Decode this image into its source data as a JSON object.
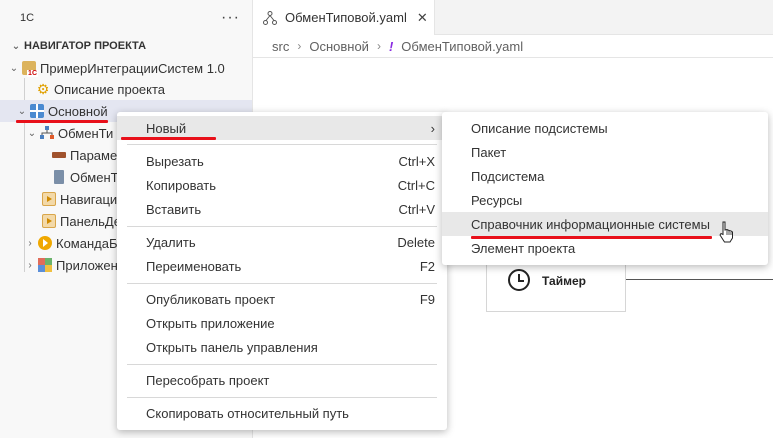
{
  "sidebar": {
    "title": "1С",
    "more": "···",
    "section": "НАВИГАТОР ПРОЕКТА",
    "items": [
      {
        "label": "ПримерИнтеграцииСистем 1.0"
      },
      {
        "label": "Описание проекта"
      },
      {
        "label": "Основной"
      },
      {
        "label": "ОбменТи"
      },
      {
        "label": "Парамет"
      },
      {
        "label": "ОбменТ"
      },
      {
        "label": "Навигаци"
      },
      {
        "label": "ПанельДе"
      },
      {
        "label": "КомандаБ"
      },
      {
        "label": "Приложен"
      }
    ]
  },
  "editor": {
    "tab": {
      "label": "ОбменТиповой.yaml",
      "close": "✕"
    },
    "breadcrumb": [
      "src",
      "Основной",
      "ОбменТиповой.yaml"
    ],
    "breadcrumb_mark": "!",
    "timer_label": "Таймер"
  },
  "context_menu": {
    "items": [
      {
        "label": "Новый",
        "shortcut": "›"
      },
      {
        "label": "Вырезать",
        "shortcut": "Ctrl+X"
      },
      {
        "label": "Копировать",
        "shortcut": "Ctrl+C"
      },
      {
        "label": "Вставить",
        "shortcut": "Ctrl+V"
      },
      {
        "label": "Удалить",
        "shortcut": "Delete"
      },
      {
        "label": "Переименовать",
        "shortcut": "F2"
      },
      {
        "label": "Опубликовать проект",
        "shortcut": "F9"
      },
      {
        "label": "Открыть приложение",
        "shortcut": ""
      },
      {
        "label": "Открыть панель управления",
        "shortcut": ""
      },
      {
        "label": "Пересобрать проект",
        "shortcut": ""
      },
      {
        "label": "Скопировать относительный путь",
        "shortcut": ""
      }
    ]
  },
  "submenu": {
    "items": [
      {
        "label": "Описание подсистемы"
      },
      {
        "label": "Пакет"
      },
      {
        "label": "Подсистема"
      },
      {
        "label": "Ресурсы"
      },
      {
        "label": "Справочник информационные системы"
      },
      {
        "label": "Элемент проекта"
      }
    ]
  },
  "colors": {
    "accent_red": "#e8101a",
    "selection": "#e4e6f1",
    "menu_hover": "#e8e8e8"
  }
}
